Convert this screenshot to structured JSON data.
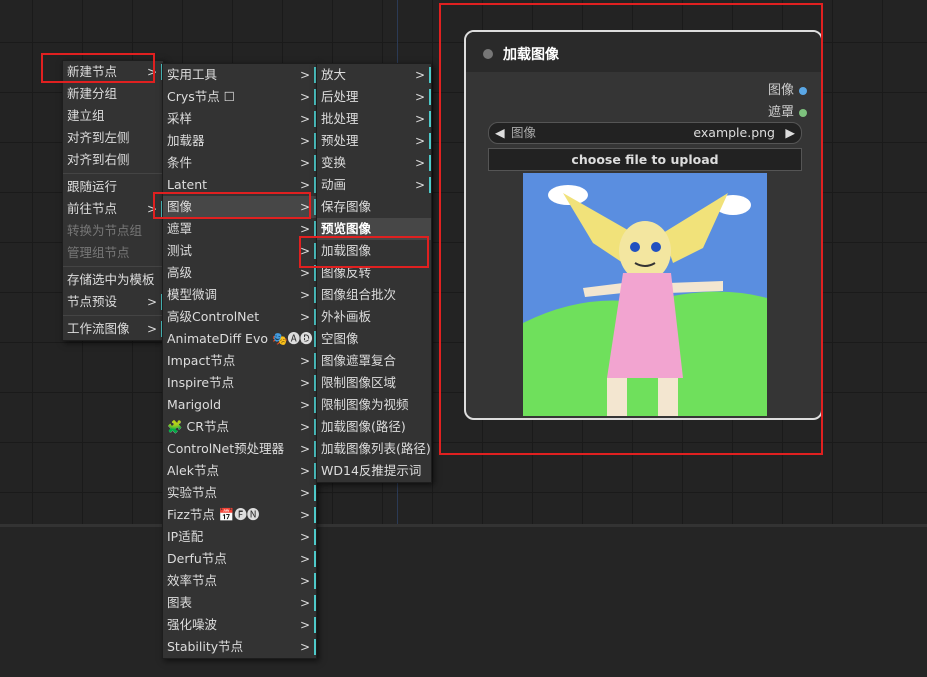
{
  "menu1": {
    "items": [
      {
        "label": "新建节点",
        "arrow": ">",
        "enabled": true
      },
      {
        "label": "新建分组",
        "enabled": true
      },
      {
        "label": "建立组",
        "enabled": true
      },
      {
        "label": "对齐到左侧",
        "enabled": true
      },
      {
        "label": "对齐到右侧",
        "enabled": true
      },
      {
        "label": "跟随运行",
        "enabled": true
      },
      {
        "label": "前往节点",
        "arrow": ">",
        "enabled": true
      },
      {
        "label": "转换为节点组",
        "enabled": false
      },
      {
        "label": "管理组节点",
        "enabled": false
      },
      {
        "label": "存储选中为模板",
        "enabled": true
      },
      {
        "label": "节点预设",
        "arrow": ">",
        "enabled": true
      },
      {
        "label": "工作流图像",
        "arrow": ">",
        "enabled": true
      }
    ]
  },
  "menu2": {
    "items": [
      {
        "label": "实用工具",
        "arrow": ">"
      },
      {
        "label": "Crys节点 ☐",
        "arrow": ">"
      },
      {
        "label": "采样",
        "arrow": ">"
      },
      {
        "label": "加载器",
        "arrow": ">"
      },
      {
        "label": "条件",
        "arrow": ">"
      },
      {
        "label": "Latent",
        "arrow": ">"
      },
      {
        "label": "图像",
        "arrow": ">"
      },
      {
        "label": "遮罩",
        "arrow": ">"
      },
      {
        "label": "测试",
        "arrow": ">"
      },
      {
        "label": "高级",
        "arrow": ">"
      },
      {
        "label": "模型微调",
        "arrow": ">"
      },
      {
        "label": "高级ControlNet",
        "arrow": ">"
      },
      {
        "label": "AnimateDiff Evo 🎭🅐🅓",
        "arrow": ">"
      },
      {
        "label": "Impact节点",
        "arrow": ">"
      },
      {
        "label": "Inspire节点",
        "arrow": ">"
      },
      {
        "label": "Marigold",
        "arrow": ">"
      },
      {
        "label": "🧩 CR节点",
        "arrow": ">"
      },
      {
        "label": "ControlNet预处理器",
        "arrow": ">"
      },
      {
        "label": "Alek节点",
        "arrow": ">"
      },
      {
        "label": "实验节点",
        "arrow": ">"
      },
      {
        "label": "Fizz节点 📅🅕🅝",
        "arrow": ">"
      },
      {
        "label": "IP适配",
        "arrow": ">"
      },
      {
        "label": "Derfu节点",
        "arrow": ">"
      },
      {
        "label": "效率节点",
        "arrow": ">"
      },
      {
        "label": "图表",
        "arrow": ">"
      },
      {
        "label": "强化噪波",
        "arrow": ">"
      },
      {
        "label": "Stability节点",
        "arrow": ">"
      }
    ]
  },
  "menu3": {
    "items": [
      {
        "label": "放大",
        "arrow": ">"
      },
      {
        "label": "后处理",
        "arrow": ">"
      },
      {
        "label": "批处理",
        "arrow": ">"
      },
      {
        "label": "预处理",
        "arrow": ">"
      },
      {
        "label": "变换",
        "arrow": ">"
      },
      {
        "label": "动画",
        "arrow": ">"
      },
      {
        "label": "保存图像"
      },
      {
        "label": "预览图像"
      },
      {
        "label": "加载图像"
      },
      {
        "label": "图像反转"
      },
      {
        "label": "图像组合批次"
      },
      {
        "label": "外补画板"
      },
      {
        "label": "空图像"
      },
      {
        "label": "图像遮罩复合"
      },
      {
        "label": "限制图像区域"
      },
      {
        "label": "限制图像为视频"
      },
      {
        "label": "加载图像(路径)"
      },
      {
        "label": "加载图像列表(路径)"
      },
      {
        "label": "WD14反推提示词"
      }
    ]
  },
  "node": {
    "title": "加载图像",
    "outputs": [
      {
        "label": "图像",
        "color": "#5aa7e6"
      },
      {
        "label": "遮罩",
        "color": "#7ec27e"
      }
    ],
    "combo": {
      "left": "◀",
      "label": "图像",
      "value": "example.png",
      "right": "▶"
    },
    "upload_label": "choose file to upload"
  },
  "colors": {
    "accent_bar": "#4ec9c9",
    "highlight_box": "#e02020"
  }
}
